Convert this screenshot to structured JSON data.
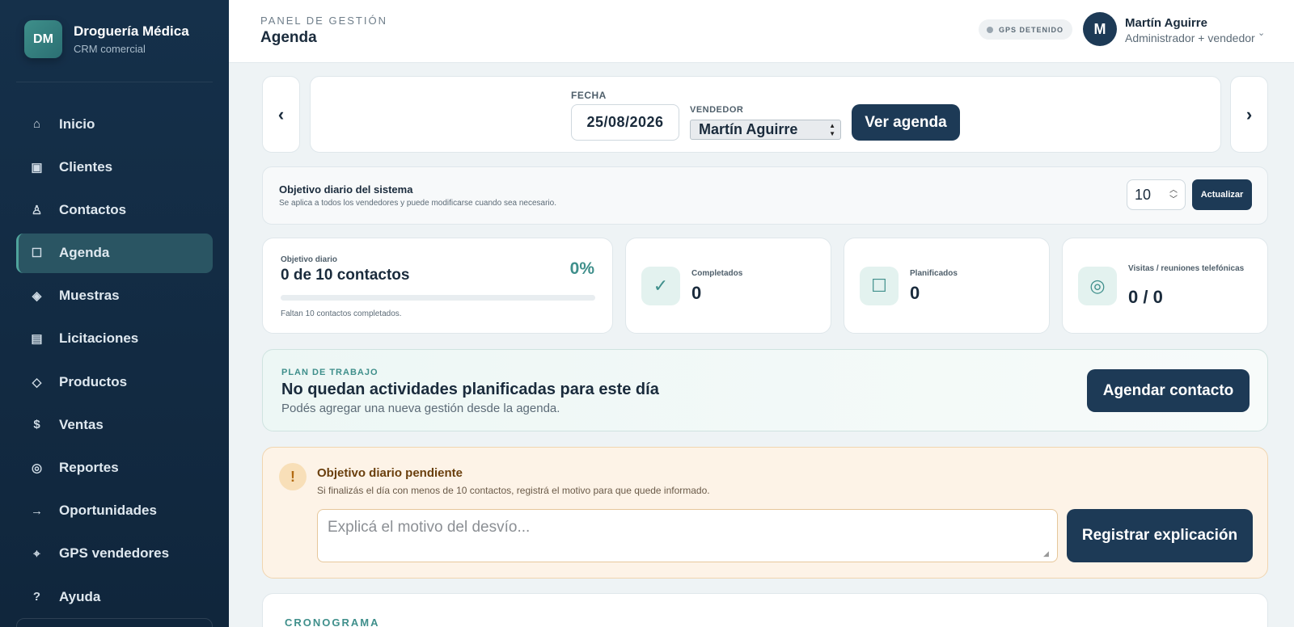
{
  "brand": {
    "logo_text": "DM",
    "name": "Droguería Médica",
    "subtitle": "CRM comercial"
  },
  "sidebar": {
    "items": [
      {
        "label": "Inicio",
        "icon": "home-icon",
        "glyph": "⌂",
        "active": false
      },
      {
        "label": "Clientes",
        "icon": "clients-icon",
        "glyph": "▣",
        "active": false
      },
      {
        "label": "Contactos",
        "icon": "contacts-icon",
        "glyph": "♙",
        "active": false
      },
      {
        "label": "Agenda",
        "icon": "agenda-icon",
        "glyph": "☐",
        "active": true
      },
      {
        "label": "Muestras",
        "icon": "samples-icon",
        "glyph": "◈",
        "active": false
      },
      {
        "label": "Licitaciones",
        "icon": "tenders-icon",
        "glyph": "▤",
        "active": false
      },
      {
        "label": "Productos",
        "icon": "products-icon",
        "glyph": "◇",
        "active": false
      },
      {
        "label": "Ventas",
        "icon": "sales-icon",
        "glyph": "$",
        "active": false
      },
      {
        "label": "Reportes",
        "icon": "reports-icon",
        "glyph": "◎",
        "active": false
      },
      {
        "label": "Oportunidades",
        "icon": "opportunities-icon",
        "glyph": "→",
        "active": false
      },
      {
        "label": "GPS vendedores",
        "icon": "gps-icon",
        "glyph": "⌖",
        "active": false
      },
      {
        "label": "Ayuda",
        "icon": "help-icon",
        "glyph": "?",
        "active": false
      }
    ]
  },
  "header": {
    "kicker": "PANEL DE GESTIÓN",
    "title": "Agenda",
    "gps_status": "GPS DETENIDO",
    "user": {
      "initial": "M",
      "name": "Martín Aguirre",
      "role": "Administrador + vendedor"
    }
  },
  "date_bar": {
    "fecha_label": "FECHA",
    "fecha_value": "25/08/2026",
    "vendedor_label": "VENDEDOR",
    "vendedor_value": "Martín Aguirre",
    "ver_button": "Ver agenda",
    "prev_glyph": "‹",
    "next_glyph": "›"
  },
  "objective": {
    "title": "Objetivo diario del sistema",
    "description": "Se aplica a todos los vendedores y puede modificarse cuando sea necesario.",
    "value": "10",
    "update_button": "Actualizar"
  },
  "stats": {
    "daily": {
      "label": "Objetivo diario",
      "value": "0 de 10 contactos",
      "percent": "0%",
      "progress": 0,
      "note": "Faltan 10 contactos completados."
    },
    "completed": {
      "label": "Completados",
      "value": "0",
      "glyph": "✓"
    },
    "planned": {
      "label": "Planificados",
      "value": "0",
      "glyph": "☐"
    },
    "visits": {
      "label": "Visitas / reuniones telefónicas",
      "value": "0 / 0",
      "glyph": "◎"
    }
  },
  "plan": {
    "kicker": "PLAN DE TRABAJO",
    "title": "No quedan actividades planificadas para este día",
    "subtitle": "Podés agregar una nueva gestión desde la agenda.",
    "button": "Agendar contacto"
  },
  "warning": {
    "glyph": "!",
    "title": "Objetivo diario pendiente",
    "description": "Si finalizás el día con menos de 10 contactos, registrá el motivo para que quede informado.",
    "placeholder": "Explicá el motivo del desvío...",
    "button": "Registrar explicación"
  },
  "cronograma": {
    "title": "CRONOGRAMA"
  },
  "colors": {
    "sidebar": "#15304a",
    "accent": "#3f8f8b",
    "primary_button": "#1d3a56",
    "warning_bg": "#fdf3e7"
  }
}
